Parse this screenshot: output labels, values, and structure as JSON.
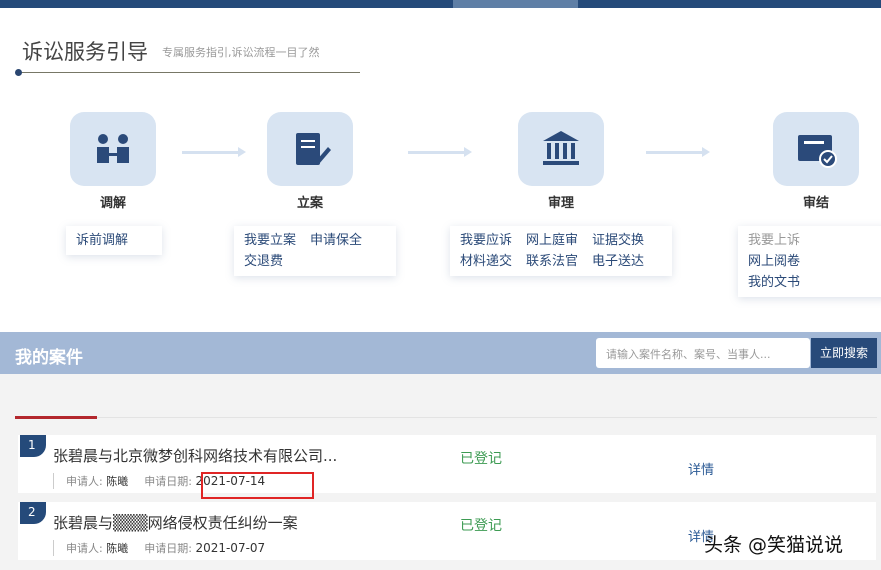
{
  "header": {
    "title": "诉讼服务引导",
    "subtitle": "专属服务指引,诉讼流程一目了然"
  },
  "steps": [
    {
      "label": "调解",
      "icon": "mediation-icon",
      "links": [
        "诉前调解"
      ]
    },
    {
      "label": "立案",
      "icon": "filing-icon",
      "links": [
        "我要立案",
        "申请保全",
        "交退费"
      ]
    },
    {
      "label": "审理",
      "icon": "court-icon",
      "links": [
        "我要应诉",
        "网上庭审",
        "证据交换",
        "材料递交",
        "联系法官",
        "电子送达"
      ]
    },
    {
      "label": "审结",
      "icon": "closed-case-icon",
      "links": [
        "我要上诉",
        "网上阅卷",
        "我的文书"
      ]
    }
  ],
  "cases_section": {
    "title": "我的案件",
    "search_placeholder": "请输入案件名称、案号、当事人...",
    "search_button": "立即搜索"
  },
  "cases": [
    {
      "index": "1",
      "name": "张碧晨与北京微梦创科网络技术有限公司...",
      "applicant_label": "申请人:",
      "applicant": "陈曦",
      "date_label": "申请日期:",
      "date": "2021-07-14",
      "status": "已登记",
      "detail": "详情"
    },
    {
      "index": "2",
      "name": "张碧晨与▒▒▒网络侵权责任纠纷一案",
      "applicant_label": "申请人:",
      "applicant": "陈曦",
      "date_label": "申请日期:",
      "date": "2021-07-07",
      "status": "已登记",
      "detail": "详情"
    }
  ],
  "watermark": "头条 @笑猫说说"
}
